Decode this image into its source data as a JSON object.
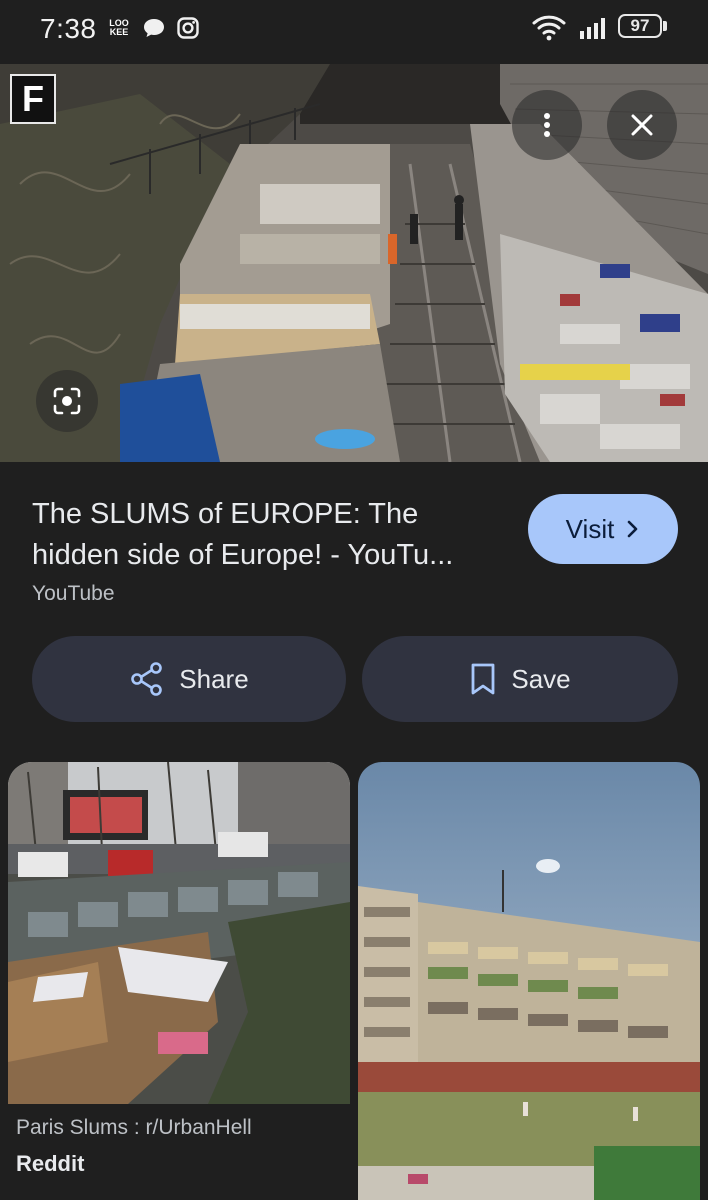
{
  "status_bar": {
    "time": "7:38",
    "battery": "97",
    "notif_badge": "LOO KEE"
  },
  "hero": {
    "logo_letter": "F",
    "more_icon": "more-vert-icon",
    "close_icon": "close-icon",
    "lens_icon": "lens-icon"
  },
  "result": {
    "title": "The SLUMS of EUROPE: The hidden side of Europe! - YouTu...",
    "source": "YouTube",
    "visit_label": "Visit"
  },
  "actions": {
    "share_label": "Share",
    "save_label": "Save"
  },
  "related": [
    {
      "caption": "Paris Slums : r/UrbanHell",
      "source": "Reddit"
    },
    {
      "caption": "",
      "source": ""
    }
  ],
  "colors": {
    "background": "#1f1f1f",
    "visit_button": "#a8c7fa",
    "pill_button": "#303340"
  }
}
